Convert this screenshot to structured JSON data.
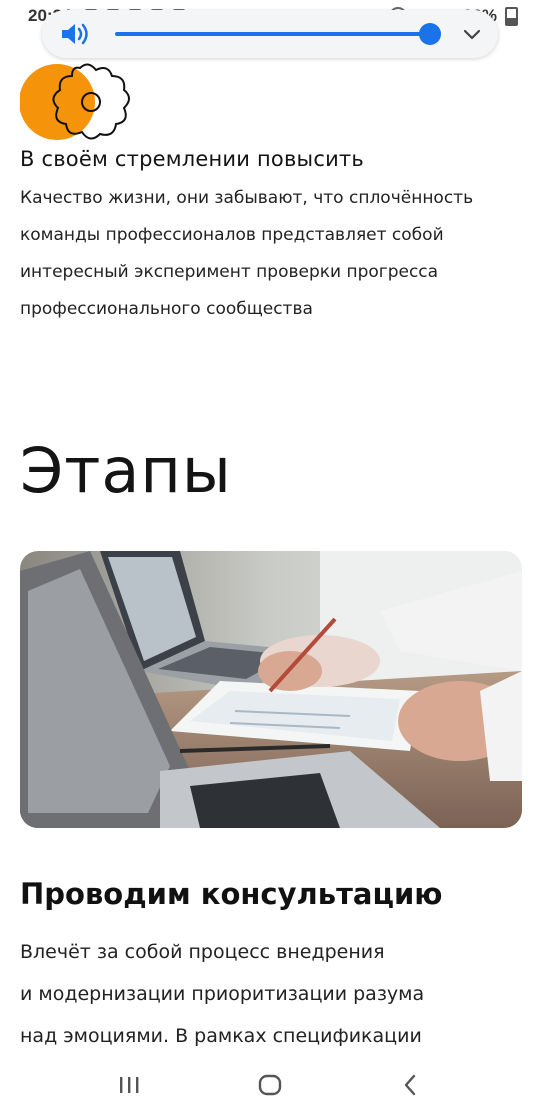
{
  "status_bar": {
    "time": "20:34",
    "battery": "36%"
  },
  "volume": {
    "level": 0.99,
    "accent": "#1a73e8"
  },
  "intro": {
    "heading": "В своём стремлении повысить",
    "lines": [
      "Качество жизни, они забывают, что сплочённость",
      "команды профессионалов представляет собой",
      "интересный эксперимент проверки прогресса",
      "профессионального сообщества"
    ]
  },
  "section": {
    "title": "Этапы"
  },
  "step": {
    "heading": "Проводим консультацию",
    "lines": [
      "Влечёт за собой процесс внедрения",
      "и модернизации приоритизации разума",
      "над эмоциями. В рамках спецификации"
    ]
  },
  "colors": {
    "logo_orange": "#f5940a",
    "text": "#141414"
  },
  "icons": {
    "volume": "speaker-icon",
    "expand": "chevron-down-icon",
    "recent": "recent-apps-icon",
    "home": "home-icon",
    "back": "back-icon"
  }
}
